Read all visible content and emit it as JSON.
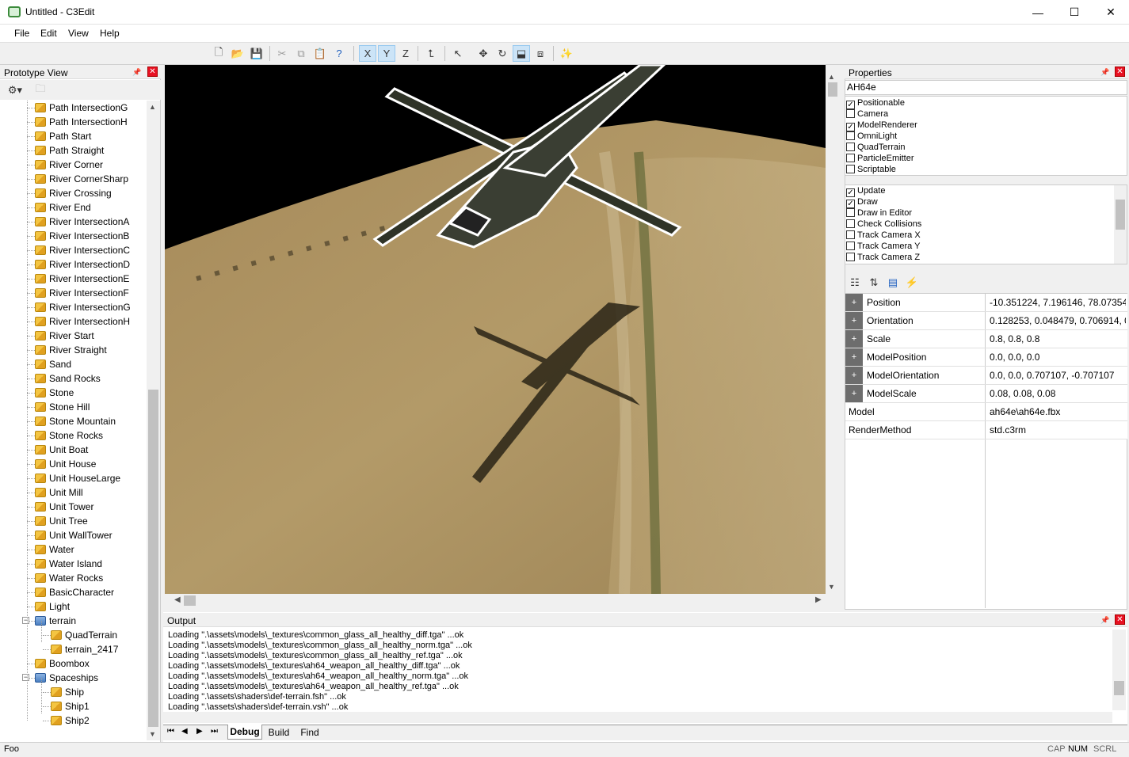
{
  "window": {
    "title": "Untitled - C3Edit",
    "minimize": "—",
    "maximize": "☐",
    "close": "✕"
  },
  "menu": [
    "File",
    "Edit",
    "View",
    "Help"
  ],
  "toolbar": {
    "axis_x": "X",
    "axis_y": "Y",
    "axis_z": "Z"
  },
  "prototype_view": {
    "title": "Prototype View",
    "items": [
      {
        "label": "Path IntersectionG",
        "level": 1
      },
      {
        "label": "Path IntersectionH",
        "level": 1
      },
      {
        "label": "Path Start",
        "level": 1
      },
      {
        "label": "Path Straight",
        "level": 1
      },
      {
        "label": "River Corner",
        "level": 1
      },
      {
        "label": "River CornerSharp",
        "level": 1
      },
      {
        "label": "River Crossing",
        "level": 1
      },
      {
        "label": "River End",
        "level": 1
      },
      {
        "label": "River IntersectionA",
        "level": 1
      },
      {
        "label": "River IntersectionB",
        "level": 1
      },
      {
        "label": "River IntersectionC",
        "level": 1
      },
      {
        "label": "River IntersectionD",
        "level": 1
      },
      {
        "label": "River IntersectionE",
        "level": 1
      },
      {
        "label": "River IntersectionF",
        "level": 1
      },
      {
        "label": "River IntersectionG",
        "level": 1
      },
      {
        "label": "River IntersectionH",
        "level": 1
      },
      {
        "label": "River Start",
        "level": 1
      },
      {
        "label": "River Straight",
        "level": 1
      },
      {
        "label": "Sand",
        "level": 1
      },
      {
        "label": "Sand Rocks",
        "level": 1
      },
      {
        "label": "Stone",
        "level": 1
      },
      {
        "label": "Stone Hill",
        "level": 1
      },
      {
        "label": "Stone Mountain",
        "level": 1
      },
      {
        "label": "Stone Rocks",
        "level": 1
      },
      {
        "label": "Unit Boat",
        "level": 1
      },
      {
        "label": "Unit House",
        "level": 1
      },
      {
        "label": "Unit HouseLarge",
        "level": 1
      },
      {
        "label": "Unit Mill",
        "level": 1
      },
      {
        "label": "Unit Tower",
        "level": 1
      },
      {
        "label": "Unit Tree",
        "level": 1
      },
      {
        "label": "Unit WallTower",
        "level": 1
      },
      {
        "label": "Water",
        "level": 1
      },
      {
        "label": "Water Island",
        "level": 1
      },
      {
        "label": "Water Rocks",
        "level": 1
      },
      {
        "label": "BasicCharacter",
        "level": 1
      },
      {
        "label": "Light",
        "level": 1
      },
      {
        "label": "terrain",
        "level": 0,
        "folder": true
      },
      {
        "label": "QuadTerrain",
        "level": 2
      },
      {
        "label": "terrain_2417",
        "level": 2
      },
      {
        "label": "Boombox",
        "level": 1
      },
      {
        "label": "Spaceships",
        "level": 0,
        "folder": true
      },
      {
        "label": "Ship",
        "level": 2
      },
      {
        "label": "Ship1",
        "level": 2
      },
      {
        "label": "Ship2",
        "level": 2
      }
    ]
  },
  "properties": {
    "title": "Properties",
    "name": "AH64e",
    "components": [
      {
        "label": "Positionable",
        "checked": true
      },
      {
        "label": "Camera",
        "checked": false
      },
      {
        "label": "ModelRenderer",
        "checked": true
      },
      {
        "label": "OmniLight",
        "checked": false
      },
      {
        "label": "QuadTerrain",
        "checked": false
      },
      {
        "label": "ParticleEmitter",
        "checked": false
      },
      {
        "label": "Scriptable",
        "checked": false
      }
    ],
    "flags": [
      {
        "label": "Update",
        "checked": true
      },
      {
        "label": "Draw",
        "checked": true
      },
      {
        "label": "Draw in Editor",
        "checked": false
      },
      {
        "label": "Check Collisions",
        "checked": false
      },
      {
        "label": "Track Camera X",
        "checked": false
      },
      {
        "label": "Track Camera Y",
        "checked": false
      },
      {
        "label": "Track Camera Z",
        "checked": false
      }
    ],
    "grid": [
      {
        "key": "Position",
        "value": "-10.351224, 7.196146, 78.07354",
        "expandable": true
      },
      {
        "key": "Orientation",
        "value": "0.128253, 0.048479, 0.706914, 0...",
        "expandable": true
      },
      {
        "key": "Scale",
        "value": "0.8, 0.8, 0.8",
        "expandable": true
      },
      {
        "key": "ModelPosition",
        "value": "0.0, 0.0, 0.0",
        "expandable": true
      },
      {
        "key": "ModelOrientation",
        "value": "0.0, 0.0, 0.707107, -0.707107",
        "expandable": true
      },
      {
        "key": "ModelScale",
        "value": "0.08, 0.08, 0.08",
        "expandable": true
      },
      {
        "key": "Model",
        "value": "ah64e\\ah64e.fbx",
        "expandable": false
      },
      {
        "key": "RenderMethod",
        "value": "std.c3rm",
        "expandable": false
      }
    ]
  },
  "output": {
    "title": "Output",
    "lines": [
      "Loading \".\\assets\\models\\_textures\\common_glass_all_healthy_diff.tga\" ...ok",
      "Loading \".\\assets\\models\\_textures\\common_glass_all_healthy_norm.tga\" ...ok",
      "Loading \".\\assets\\models\\_textures\\common_glass_all_healthy_ref.tga\" ...ok",
      "Loading \".\\assets\\models\\_textures\\ah64_weapon_all_healthy_diff.tga\" ...ok",
      "Loading \".\\assets\\models\\_textures\\ah64_weapon_all_healthy_norm.tga\" ...ok",
      "Loading \".\\assets\\models\\_textures\\ah64_weapon_all_healthy_ref.tga\" ...ok",
      "Loading \".\\assets\\shaders\\def-terrain.fsh\" ...ok",
      "Loading \".\\assets\\shaders\\def-terrain.vsh\" ...ok"
    ],
    "tabs": [
      "Debug",
      "Build",
      "Find"
    ]
  },
  "status": {
    "text": "Foo",
    "cap": "CAP",
    "num": "NUM",
    "scrl": "SCRL"
  }
}
